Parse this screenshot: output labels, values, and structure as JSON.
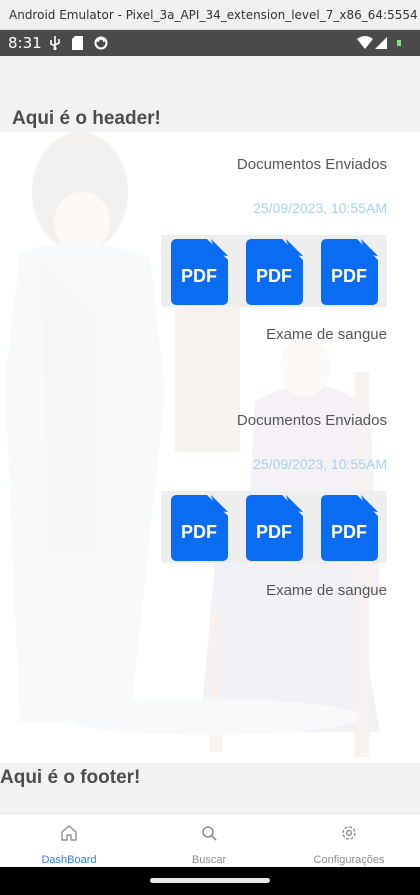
{
  "window": {
    "title": "Android Emulator - Pixel_3a_API_34_extension_level_7_x86_64:5554"
  },
  "status_bar": {
    "time": "8:31"
  },
  "header": {
    "text": "Aqui é o header!"
  },
  "documents": [
    {
      "title": "Documentos Enviados",
      "date": "25/09/2023, 10:55AM",
      "files": [
        {
          "label": "PDF"
        },
        {
          "label": "PDF"
        },
        {
          "label": "PDF"
        }
      ],
      "label": "Exame de sangue"
    },
    {
      "title": "Documentos Enviados",
      "date": "25/09/2023, 10:55AM",
      "files": [
        {
          "label": "PDF"
        },
        {
          "label": "PDF"
        },
        {
          "label": "PDF"
        }
      ],
      "label": "Exame de sangue"
    }
  ],
  "footer": {
    "text": "Aqui é o footer!"
  },
  "tabs": [
    {
      "label": "DashBoard",
      "icon": "home-icon",
      "active": true
    },
    {
      "label": "Buscar",
      "icon": "search-icon",
      "active": false
    },
    {
      "label": "Configurações",
      "icon": "gear-icon",
      "active": false
    }
  ],
  "colors": {
    "pdf_blue": "#0a6cf2",
    "active_tab": "#2f7de1",
    "date": "#a6d3ea"
  }
}
